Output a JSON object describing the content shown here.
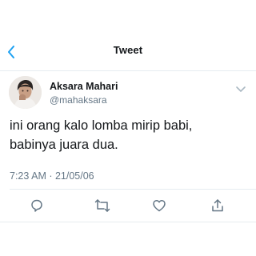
{
  "header": {
    "title": "Tweet",
    "back_icon": "chevron-left-icon"
  },
  "author": {
    "name": "Aksara Mahari",
    "handle": "@mahaksara",
    "avatar_icon": "avatar-photo"
  },
  "tweet": {
    "lines": [
      "ini orang kalo lomba mirip babi,",
      "babinya juara dua."
    ],
    "timestamp": "7:23 AM · 21/05/06"
  },
  "actions": [
    {
      "name": "reply-icon"
    },
    {
      "name": "retweet-icon"
    },
    {
      "name": "like-icon"
    },
    {
      "name": "share-icon"
    }
  ],
  "colors": {
    "accent": "#1da1f2",
    "text": "#14171a",
    "muted": "#657786",
    "border": "#e6ecf0"
  }
}
